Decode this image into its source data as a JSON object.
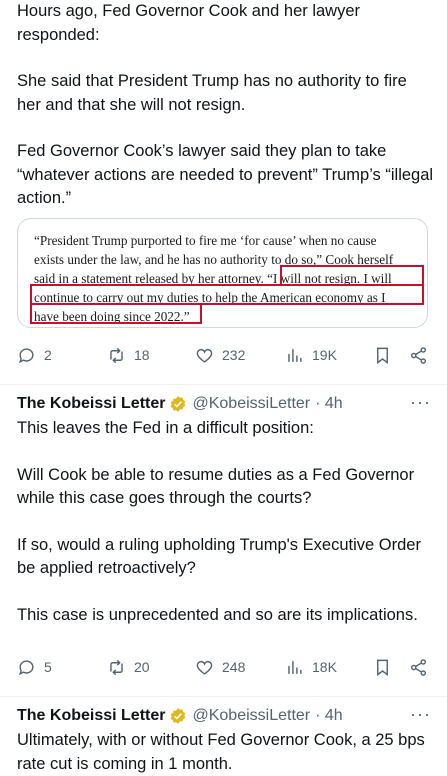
{
  "post1": {
    "paragraphs": [
      "Hours ago, Fed Governor Cook and her lawyer responded:",
      "She said that President Trump has no authority to fire her and that she will not resign.",
      "Fed Governor Cook’s lawyer said they plan to take “whatever actions are needed to prevent” Trump’s “illegal action.”"
    ],
    "quote_lines": [
      "“President Trump purported to fire me ‘for cause’ when no cause",
      "exists under the law, and he has no authority to do so,” Cook herself",
      "said in a statement released by her attorney. “I will not resign. I will",
      "continue to carry out my duties to help the American economy as I",
      "have been doing since 2022.”"
    ],
    "actions": {
      "replies": "2",
      "reposts": "18",
      "likes": "232",
      "views": "19K"
    }
  },
  "post2": {
    "author": "The Kobeissi Letter",
    "handle": "@KobeissiLetter",
    "time": "· 4h",
    "paragraphs": [
      "This leaves the Fed in a difficult position:",
      "Will Cook be able to resume duties as a Fed Governor while this case goes through the courts?",
      "If so, would a ruling upholding Trump's Executive Order be applied retroactively?",
      "This case is unprecedented and so are its implications."
    ],
    "actions": {
      "replies": "5",
      "reposts": "20",
      "likes": "248",
      "views": "18K"
    }
  },
  "post3": {
    "author": "The Kobeissi Letter",
    "handle": "@KobeissiLetter",
    "time": "· 4h",
    "paragraphs": [
      "Ultimately, with or without Fed Governor Cook, a 25 bps rate cut is coming in 1 month."
    ]
  },
  "more_label": "···",
  "colors": {
    "text": "#0f1419",
    "muted": "#536471",
    "highlight_box": "#c8102e",
    "verified": "#e2b719"
  }
}
